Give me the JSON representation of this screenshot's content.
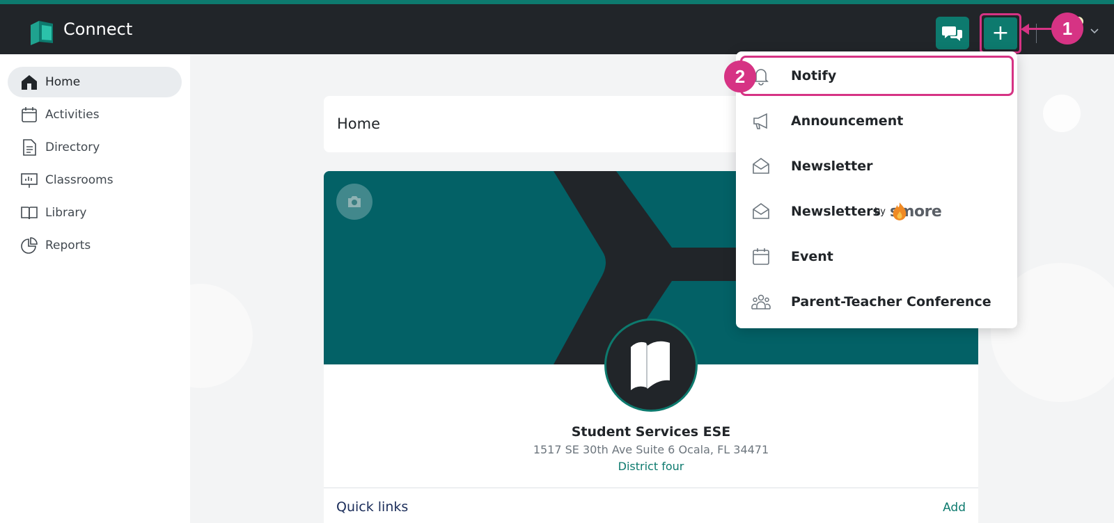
{
  "header": {
    "app_title": "Connect",
    "plus_label": "+"
  },
  "colors": {
    "brand": "#0d7a6e",
    "header_bg": "#212529",
    "annotation": "#d63384"
  },
  "annotations": {
    "badge_1": "1",
    "badge_2": "2"
  },
  "sidebar": {
    "items": [
      {
        "label": "Home",
        "icon": "home-icon",
        "active": true
      },
      {
        "label": "Activities",
        "icon": "calendar-icon",
        "active": false
      },
      {
        "label": "Directory",
        "icon": "document-icon",
        "active": false
      },
      {
        "label": "Classrooms",
        "icon": "presentation-board-icon",
        "active": false
      },
      {
        "label": "Library",
        "icon": "open-book-icon",
        "active": false
      },
      {
        "label": "Reports",
        "icon": "pie-chart-icon",
        "active": false
      }
    ]
  },
  "main": {
    "page_title": "Home",
    "school": {
      "name": "Student Services ESE",
      "address": "1517 SE 30th Ave Suite 6 Ocala, FL 34471",
      "district": "District four"
    },
    "quick_links": {
      "title": "Quick links",
      "add_label": "Add"
    }
  },
  "create_menu": {
    "items": [
      {
        "label": "Notify",
        "icon": "bell-icon"
      },
      {
        "label": "Announcement",
        "icon": "megaphone-icon"
      },
      {
        "label": "Newsletter",
        "icon": "envelope-open-icon"
      },
      {
        "label": "Newsletters",
        "icon": "envelope-open-icon",
        "by": "by",
        "brand": "smore"
      },
      {
        "label": "Event",
        "icon": "calendar-icon"
      },
      {
        "label": "Parent-Teacher Conference",
        "icon": "people-group-icon"
      }
    ]
  }
}
